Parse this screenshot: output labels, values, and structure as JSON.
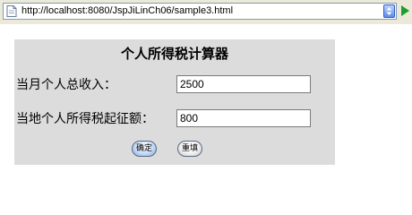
{
  "browser": {
    "url": "http://localhost:8080/JspJiLinCh06/sample3.html"
  },
  "form": {
    "title": "个人所得税计算器",
    "income_label": "当月个人总收入：",
    "income_value": "2500",
    "threshold_label": "当地个人所得税起征额：",
    "threshold_value": "800",
    "submit_label": "确定",
    "reset_label": "重填"
  },
  "colors": {
    "panel_background": "#dcdcdc",
    "go_arrow": "#1a9e2e"
  }
}
